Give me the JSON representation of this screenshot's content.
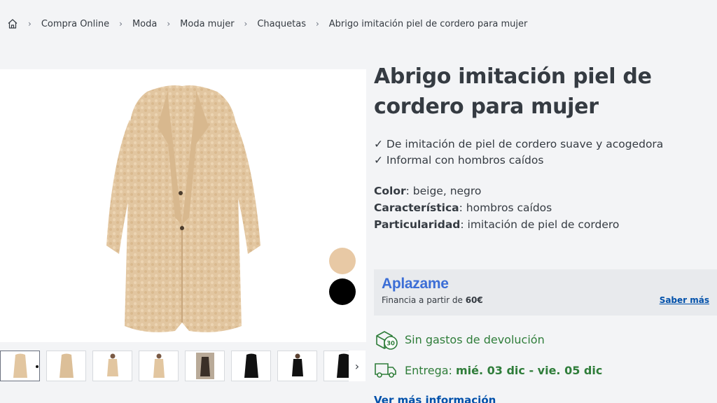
{
  "breadcrumb": {
    "home_icon": "home-icon",
    "items": [
      "Compra Online",
      "Moda",
      "Moda mujer",
      "Chaquetas",
      "Abrigo imitación piel de cordero para mujer"
    ]
  },
  "product": {
    "title": "Abrigo imitación piel de cordero para mujer",
    "benefits": [
      "✓ De imitación de piel de cordero suave y acogedora",
      "✓ Informal con hombros caídos"
    ],
    "attributes": [
      {
        "label": "Color",
        "value": ": beige, negro"
      },
      {
        "label": "Característica",
        "value": ": hombros caídos"
      },
      {
        "label": "Particularidad",
        "value": ": imitación de piel de cordero"
      }
    ],
    "swatches": [
      {
        "name": "beige",
        "color": "#e8c9a5"
      },
      {
        "name": "negro",
        "color": "#000000"
      }
    ],
    "thumbnail_count": 8
  },
  "financing": {
    "brand": "Aplazame",
    "text_prefix": "Financia a partir de ",
    "amount": "60€",
    "link": "Saber más"
  },
  "shipping": {
    "returns_text": "Sin gastos de devolución",
    "returns_icon": "return-box-icon",
    "delivery_label": "Entrega: ",
    "delivery_dates": "mié. 03 dic - vie. 05 dic",
    "delivery_icon": "truck-icon",
    "more_info": "Ver más información"
  },
  "colors": {
    "text": "#353b42",
    "green": "#2f7d3a",
    "link": "#0050aa",
    "aplazame_blue": "#3c6ed6"
  }
}
